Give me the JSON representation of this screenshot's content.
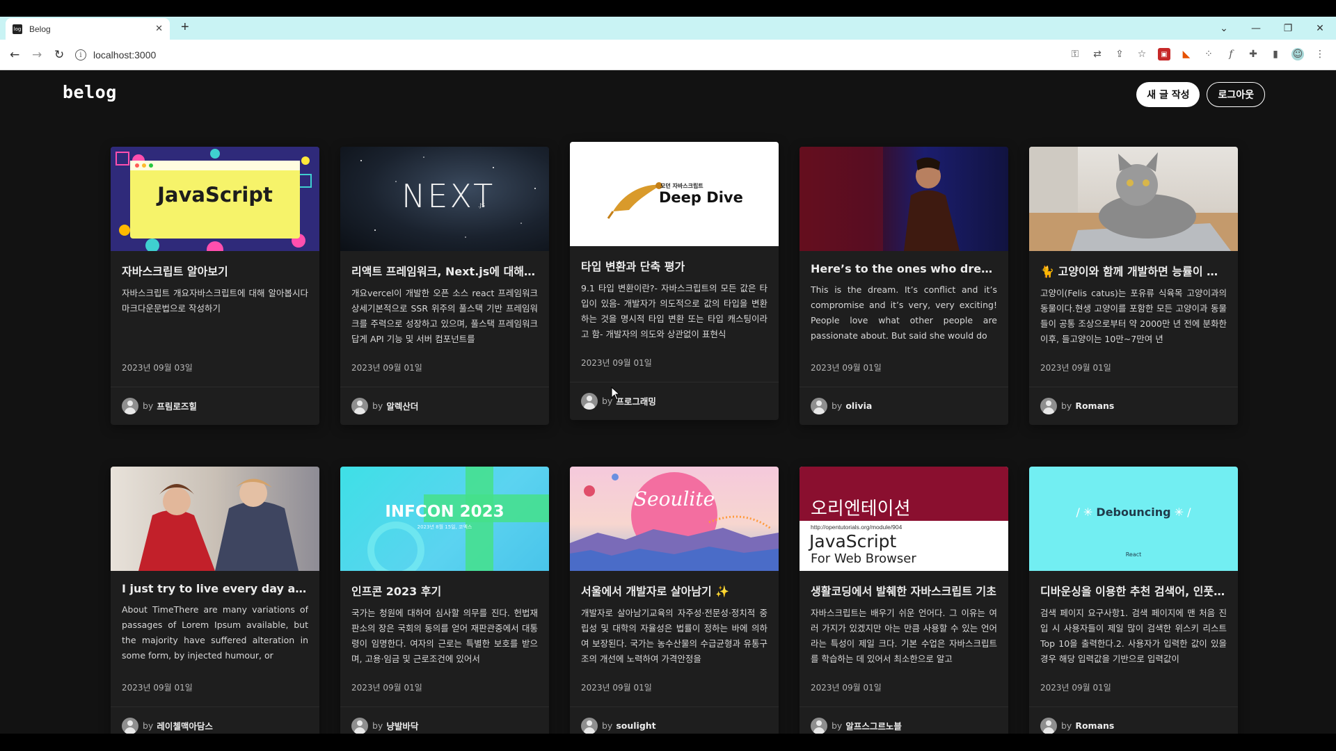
{
  "browser": {
    "tab_title": "Belog",
    "tab_favicon": "log",
    "url": "localhost:3000"
  },
  "header": {
    "logo": "belog",
    "write_button": "새 글 작성",
    "logout_button": "로그아웃"
  },
  "posts": [
    {
      "title": "자바스크립트 알아보기",
      "desc": "자바스크립트 개요자바스크립트에 대해 알아봅시다 마크다운문법으로 작성하기",
      "date": "2023년 09월 03일",
      "author": "프림로즈힐",
      "thumb_text": "JavaScript"
    },
    {
      "title": "리액트 프레임워크, Next.js에 대해 알아보자",
      "desc": "개요vercel이 개발한 오픈 소스 react 프레임워크 상세기본적으로 SSR 위주의 풀스택 기반 프레임워크를 주력으로 성장하고 있으며, 풀스택 프레임워크답게 API 기능 및 서버 컴포넌트를",
      "date": "2023년 09월 01일",
      "author": "알렉산더",
      "thumb_text": "NEXT",
      "thumb_sub": ".JS"
    },
    {
      "title": "타입 변환과 단축 평가",
      "desc": "9.1 타입 변환이란?- 자바스크립트의 모든 값은 타입이 있음- 개발자가 의도적으로 값의 타입을 변환하는 것을 명시적 타입 변환 또는 타입 캐스팅이라고 함- 개발자의 의도와 상관없이 표현식",
      "date": "2023년 09월 01일",
      "author": "프로그래밍",
      "thumb_text": "Deep Dive",
      "thumb_sub": "모던 자바스크립트"
    },
    {
      "title": "Here’s to the ones who dream, foolish as they may seem",
      "desc": "This is the dream. It’s conflict and it’s compromise and it’s very, very exciting! People love what other people are passionate about. But said she would do",
      "date": "2023년 09월 01일",
      "author": "olivia"
    },
    {
      "title": "🐈 고양이와 함께 개발하면 능률이 오른다",
      "desc": "고양이(Felis catus)는 포유류 식육목 고양이과의 동물이다.현생 고양이를 포함한 모든 고양이과 동물들이 공통 조상으로부터 약 2000만 년 전에 분화한 이후, 들고양이는 10만~7만여 년",
      "date": "2023년 09월 01일",
      "author": "Romans"
    },
    {
      "title": "I just try to live every day as if I've deliberately come back",
      "desc": "About TimeThere are many variations of passages of Lorem Ipsum available, but the majority have suffered alteration in some form, by injected humour, or",
      "date": "2023년 09월 01일",
      "author": "레이첼맥아담스"
    },
    {
      "title": "인프콘 2023 후기",
      "desc": "국가는 청원에 대하여 심사할 의무를 진다. 헌법재판소의 장은 국회의 동의를 얻어 재판관중에서 대통령이 임명한다. 여자의 근로는 특별한 보호를 받으며, 고용·임금 및 근로조건에 있어서",
      "date": "2023년 09월 01일",
      "author": "냥발바닥",
      "thumb_text": "INFCON 2023",
      "thumb_sub": "2023년 8월 15일, 코엑스"
    },
    {
      "title": "서울에서 개발자로 살아남기 ✨",
      "desc": "개발자로 살아남기교육의 자주성·전문성·정치적 중립성 및 대학의 자율성은 법률이 정하는 바에 의하여 보장된다. 국가는 농수산물의 수급균형과 유통구조의 개선에 노력하여 가격안정을",
      "date": "2023년 09월 01일",
      "author": "soulight",
      "thumb_text": "Seoulite"
    },
    {
      "title": "생활코딩에서 발췌한 자바스크립트 기초",
      "desc": "자바스크립트는 배우기 쉬운 언어다. 그 이유는 여러 가지가 있겠지만 아는 만큼 사용할 수 있는 언어라는 특성이 제일 크다. 기본 수업은 자바스크립트를 학습하는 데 있어서 최소한으로 알고",
      "date": "2023년 09월 01일",
      "author": "알프스그르노블",
      "thumb_text": "오리엔테이션",
      "thumb_url": "http://opentutorials.org/module/904",
      "thumb_line1": "JavaScript",
      "thumb_line2": "For Web Browser"
    },
    {
      "title": "디바운싱을 이용한 추천 검색어, 인풋 최적화",
      "desc": "검색 페이지 요구사항1. 검색 페이지에 맨 처음 진입 시 사용자들이 제일 많이 검색한 위스키 리스트 Top 10을 출력한다.2. 사용자가 입력한 값이 있을 경우 해당 입력값을 기반으로 입력값이",
      "date": "2023년 09월 01일",
      "author": "Romans",
      "thumb_text": "Debouncing",
      "thumb_sub": "React"
    }
  ],
  "by_label": "by",
  "colors": {
    "page_bg": "#121212",
    "card_bg": "#1e1e1e",
    "tabbar": "#c9f3f4"
  }
}
